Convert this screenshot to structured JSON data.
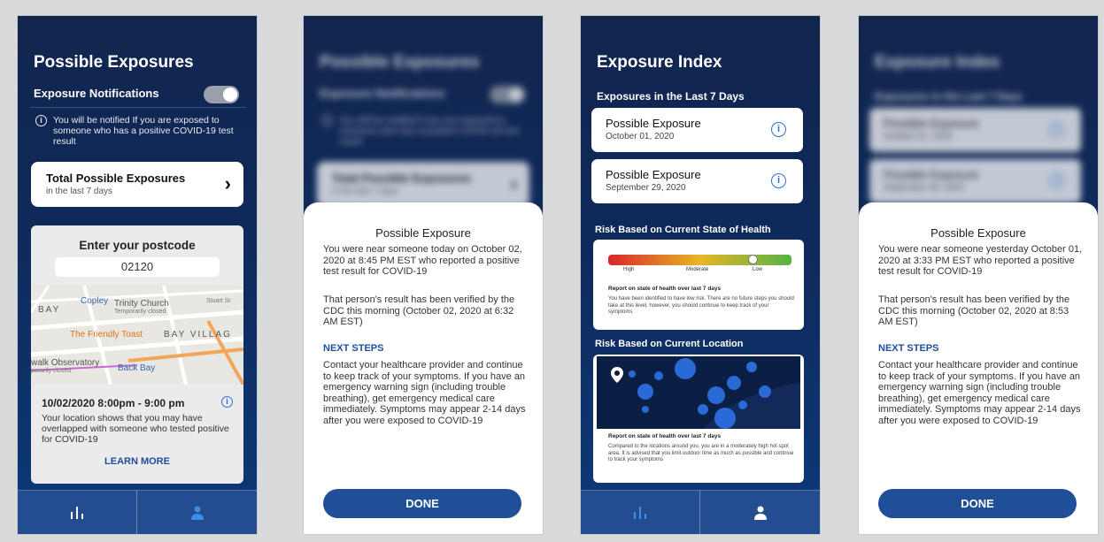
{
  "screen1": {
    "title": "Possible Exposures",
    "toggle_label": "Exposure Notifications",
    "info_text": "You will be notified If you are exposed to someone who has a positive COVID-19 test result",
    "total_card": {
      "title": "Total Possible Exposures",
      "subtitle": "in the last 7 days"
    },
    "postcode": {
      "label": "Enter your postcode",
      "value": "02120"
    },
    "map_labels": {
      "bay": "BAY",
      "copley": "Copley",
      "church": "Trinity Church",
      "church_status": "Temporarily closed",
      "stuart": "Stuart St",
      "toast": "The Friendly Toast",
      "bay_village": "BAY VILLAG",
      "walk": "walk Observatory",
      "walk_status": "porarily closed",
      "back_bay": "Back Bay"
    },
    "exposure_time": "10/02/2020   8:00pm - 9:00 pm",
    "exposure_desc": "Your location shows that you may have overlapped with someone who tested positive for COVID-19",
    "learn_more": "LEARN MORE"
  },
  "screen2": {
    "sheet_title": "Possible Exposure",
    "para1": "You were near someone today on October 02, 2020 at 8:45 PM EST who reported a positive test result for COVID-19",
    "para2": "That person's result has been verified by the CDC this morning (October 02, 2020 at 6:32 AM EST)",
    "next_steps": "NEXT STEPS",
    "para3": "Contact your healthcare provider and continue to keep track of your symptoms. If you have an emergency warning sign (including trouble breathing), get emergency medical care immediately. Symptoms may appear 2-14 days after you were exposed to COVID-19",
    "done": "DONE"
  },
  "screen3": {
    "title": "Exposure Index",
    "subtitle": "Exposures in the Last 7 Days",
    "cards": [
      {
        "title": "Possible Exposure",
        "date": "October 01, 2020"
      },
      {
        "title": "Possible Exposure",
        "date": "September 29, 2020"
      }
    ],
    "risk_health_title": "Risk Based on Current State of Health",
    "risk_levels": {
      "high": "High",
      "moderate": "Moderate",
      "low": "Low"
    },
    "risk_health_report": "Report on state of health over last 7 days",
    "risk_health_desc": "You have been identified to have low risk. There are no future steps you should take at this level, however, you should continue to keep track of your symptoms",
    "risk_location_title": "Risk Based on Current Location",
    "risk_location_report": "Report on state of health over last 7 days",
    "risk_location_desc": "Compared to the locations around you, you are in a moderately high hot spot area. It is advised that you limit outdoor time as much as possible and continue to track your symptoms"
  },
  "screen4": {
    "sheet_title": "Possible Exposure",
    "para1": "You were near someone yesterday October 01, 2020 at 3:33 PM EST who reported a positive test result for COVID-19",
    "para2": "That person's result has been verified by the CDC this morning (October 02, 2020 at 8:53 AM EST)",
    "next_steps": "NEXT STEPS",
    "para3": "Contact your healthcare provider and continue to keep track of your symptoms. If you have an emergency warning sign (including trouble breathing), get emergency medical care immediately. Symptoms may appear 2-14 days after you were exposed to COVID-19",
    "done": "DONE"
  },
  "colors": {
    "navy": "#0e2a5c",
    "accent": "#1e4f97",
    "link": "#1f4e9e",
    "info": "#2b6fd6"
  }
}
